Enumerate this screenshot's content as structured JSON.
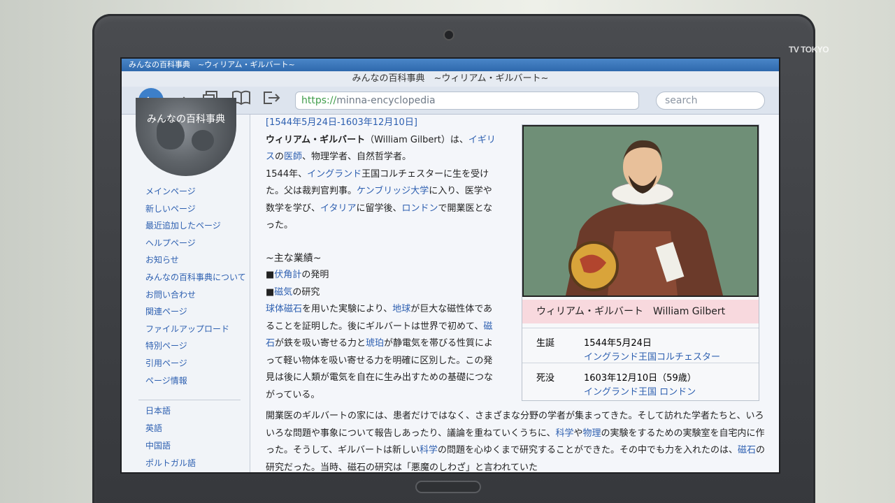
{
  "watermark": "TV TOKYO",
  "browser": {
    "tab_title": "みんなの百科事典　~ウィリアム・ギルバート~",
    "window_title": "みんなの百科事典　~ウィリアム・ギルバート~",
    "url_protocol": "https://",
    "url_rest": "minna-encyclopedia",
    "search_placeholder": "search",
    "icons": [
      "back-arrow-icon",
      "forward-arrow-icon",
      "copy-icon",
      "book-icon",
      "exit-icon"
    ]
  },
  "sidebar": {
    "logo_text": "みんなの百科事典",
    "nav_items": [
      "メインページ",
      "新しいページ",
      "最近追加したページ",
      "ヘルプページ",
      "お知らせ",
      "みんなの百科事典について",
      "お問い合わせ",
      "関連ページ",
      "ファイルアップロード",
      "特別ページ",
      "引用ページ",
      "ページ情報"
    ],
    "languages": [
      "日本語",
      "英語",
      "中国語",
      "ポルトガル語"
    ]
  },
  "article": {
    "dates": "[1544年5月24日-1603年12月10日]",
    "p1": {
      "name": "ウィリアム・ギルバート",
      "seg1": "（William Gilbert）は、",
      "link_igirisu": "イギリス",
      "seg2": "の",
      "link_ishi": "医師",
      "seg3": "、物理学者、自然哲学者。"
    },
    "p2": {
      "seg1": "1544年、",
      "link_england": "イングランド",
      "seg2": "王国コルチェスターに生を受けた。父は裁判官判事。",
      "link_cambridge": "ケンブリッジ大学",
      "seg3": "に入り、医学や数学を学び、",
      "link_italy": "イタリア",
      "seg4": "に留学後、",
      "link_london": "ロンドン",
      "seg5": "で開業医となった。"
    },
    "heading": "~主な業績~",
    "bullets": [
      {
        "mark": "■",
        "link": "伏角計",
        "text": "の発明"
      },
      {
        "mark": "■",
        "link": "磁気",
        "text": "の研究"
      }
    ],
    "p3": {
      "link_kyutai": "球体磁石",
      "seg1": "を用いた実験により、",
      "link_chikyu": "地球",
      "seg2": "が巨大な磁性体であることを証明した。後にギルバートは世界で初めて、",
      "link_jishaku": "磁石",
      "seg3": "が鉄を吸い寄せる力と",
      "link_kohaku": "琥珀",
      "seg4": "が静電気を帯びる性質によって軽い物体を吸い寄せる力を明確に区別した。この発見は後に人類が電気を自在に生み出すための基礎につながっている。"
    },
    "p4": {
      "seg1": "開業医のギルバートの家には、患者だけではなく、さまざまな分野の学者が集まってきた。そして訪れた学者たちと、いろいろな問題や事象について報告しあったり、議論を重ねていくうちに、",
      "link_kagaku": "科学",
      "seg2": "や",
      "link_butsuri": "物理",
      "seg3": "の実験をするための実験室を自宅内に作った。そうして、ギルバートは新しい",
      "link_kagaku2": "科学",
      "seg4": "の問題を心ゆくまで研究することができた。その中でも力を入れたのは、",
      "link_jishaku2": "磁石",
      "seg5": "の研究だった。当時、磁石の研究は「悪魔のしわざ」と言われていた"
    }
  },
  "infobox": {
    "caption": "ウィリアム・ギルバート　William Gilbert",
    "birth_label": "生誕",
    "birth_date": "1544年5月24日",
    "birth_place": "イングランド王国コルチェスター",
    "death_label": "死没",
    "death_date": "1603年12月10日（59歳）",
    "death_place": "イングランド王国 ロンドン"
  }
}
